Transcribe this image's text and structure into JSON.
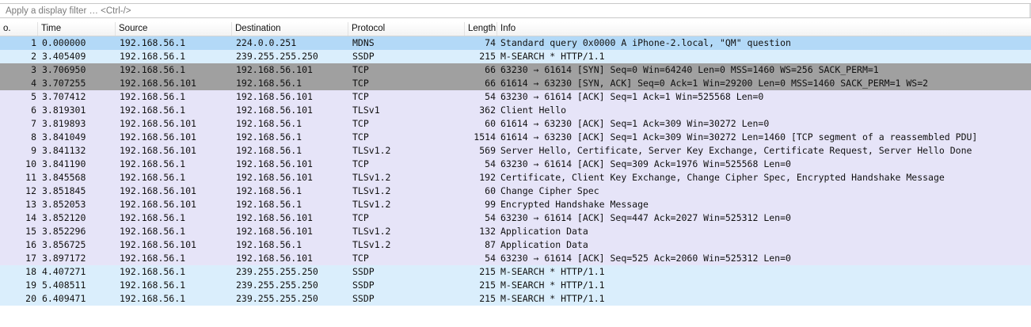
{
  "colors": {
    "selected": "#b3d9f7",
    "udp": "#daeefc",
    "tcp_syn": "#a0a0a0",
    "tcp": "#e6e4f8"
  },
  "filter": {
    "placeholder": "Apply a display filter … <Ctrl-/>"
  },
  "columns": {
    "no": "o.",
    "time": "Time",
    "source": "Source",
    "destination": "Destination",
    "protocol": "Protocol",
    "length": "Length",
    "info": "Info"
  },
  "packets": [
    {
      "no": "1",
      "time": "0.000000",
      "source": "192.168.56.1",
      "destination": "224.0.0.251",
      "protocol": "MDNS",
      "length": "74",
      "info": "Standard query 0x0000 A iPhone-2.local, \"QM\" question",
      "style": "selected"
    },
    {
      "no": "2",
      "time": "3.405409",
      "source": "192.168.56.1",
      "destination": "239.255.255.250",
      "protocol": "SSDP",
      "length": "215",
      "info": "M-SEARCH * HTTP/1.1",
      "style": "udp"
    },
    {
      "no": "3",
      "time": "3.706950",
      "source": "192.168.56.1",
      "destination": "192.168.56.101",
      "protocol": "TCP",
      "length": "66",
      "info": "63230 → 61614 [SYN] Seq=0 Win=64240 Len=0 MSS=1460 WS=256 SACK_PERM=1",
      "style": "tcp_syn"
    },
    {
      "no": "4",
      "time": "3.707255",
      "source": "192.168.56.101",
      "destination": "192.168.56.1",
      "protocol": "TCP",
      "length": "66",
      "info": "61614 → 63230 [SYN, ACK] Seq=0 Ack=1 Win=29200 Len=0 MSS=1460 SACK_PERM=1 WS=2",
      "style": "tcp_syn"
    },
    {
      "no": "5",
      "time": "3.707412",
      "source": "192.168.56.1",
      "destination": "192.168.56.101",
      "protocol": "TCP",
      "length": "54",
      "info": "63230 → 61614 [ACK] Seq=1 Ack=1 Win=525568 Len=0",
      "style": "tcp"
    },
    {
      "no": "6",
      "time": "3.819301",
      "source": "192.168.56.1",
      "destination": "192.168.56.101",
      "protocol": "TLSv1",
      "length": "362",
      "info": "Client Hello",
      "style": "tcp"
    },
    {
      "no": "7",
      "time": "3.819893",
      "source": "192.168.56.101",
      "destination": "192.168.56.1",
      "protocol": "TCP",
      "length": "60",
      "info": "61614 → 63230 [ACK] Seq=1 Ack=309 Win=30272 Len=0",
      "style": "tcp"
    },
    {
      "no": "8",
      "time": "3.841049",
      "source": "192.168.56.101",
      "destination": "192.168.56.1",
      "protocol": "TCP",
      "length": "1514",
      "info": "61614 → 63230 [ACK] Seq=1 Ack=309 Win=30272 Len=1460 [TCP segment of a reassembled PDU]",
      "style": "tcp"
    },
    {
      "no": "9",
      "time": "3.841132",
      "source": "192.168.56.101",
      "destination": "192.168.56.1",
      "protocol": "TLSv1.2",
      "length": "569",
      "info": "Server Hello, Certificate, Server Key Exchange, Certificate Request, Server Hello Done",
      "style": "tcp"
    },
    {
      "no": "10",
      "time": "3.841190",
      "source": "192.168.56.1",
      "destination": "192.168.56.101",
      "protocol": "TCP",
      "length": "54",
      "info": "63230 → 61614 [ACK] Seq=309 Ack=1976 Win=525568 Len=0",
      "style": "tcp"
    },
    {
      "no": "11",
      "time": "3.845568",
      "source": "192.168.56.1",
      "destination": "192.168.56.101",
      "protocol": "TLSv1.2",
      "length": "192",
      "info": "Certificate, Client Key Exchange, Change Cipher Spec, Encrypted Handshake Message",
      "style": "tcp"
    },
    {
      "no": "12",
      "time": "3.851845",
      "source": "192.168.56.101",
      "destination": "192.168.56.1",
      "protocol": "TLSv1.2",
      "length": "60",
      "info": "Change Cipher Spec",
      "style": "tcp"
    },
    {
      "no": "13",
      "time": "3.852053",
      "source": "192.168.56.101",
      "destination": "192.168.56.1",
      "protocol": "TLSv1.2",
      "length": "99",
      "info": "Encrypted Handshake Message",
      "style": "tcp"
    },
    {
      "no": "14",
      "time": "3.852120",
      "source": "192.168.56.1",
      "destination": "192.168.56.101",
      "protocol": "TCP",
      "length": "54",
      "info": "63230 → 61614 [ACK] Seq=447 Ack=2027 Win=525312 Len=0",
      "style": "tcp"
    },
    {
      "no": "15",
      "time": "3.852296",
      "source": "192.168.56.1",
      "destination": "192.168.56.101",
      "protocol": "TLSv1.2",
      "length": "132",
      "info": "Application Data",
      "style": "tcp"
    },
    {
      "no": "16",
      "time": "3.856725",
      "source": "192.168.56.101",
      "destination": "192.168.56.1",
      "protocol": "TLSv1.2",
      "length": "87",
      "info": "Application Data",
      "style": "tcp"
    },
    {
      "no": "17",
      "time": "3.897172",
      "source": "192.168.56.1",
      "destination": "192.168.56.101",
      "protocol": "TCP",
      "length": "54",
      "info": "63230 → 61614 [ACK] Seq=525 Ack=2060 Win=525312 Len=0",
      "style": "tcp"
    },
    {
      "no": "18",
      "time": "4.407271",
      "source": "192.168.56.1",
      "destination": "239.255.255.250",
      "protocol": "SSDP",
      "length": "215",
      "info": "M-SEARCH * HTTP/1.1",
      "style": "udp"
    },
    {
      "no": "19",
      "time": "5.408511",
      "source": "192.168.56.1",
      "destination": "239.255.255.250",
      "protocol": "SSDP",
      "length": "215",
      "info": "M-SEARCH * HTTP/1.1",
      "style": "udp"
    },
    {
      "no": "20",
      "time": "6.409471",
      "source": "192.168.56.1",
      "destination": "239.255.255.250",
      "protocol": "SSDP",
      "length": "215",
      "info": "M-SEARCH * HTTP/1.1",
      "style": "udp"
    }
  ]
}
